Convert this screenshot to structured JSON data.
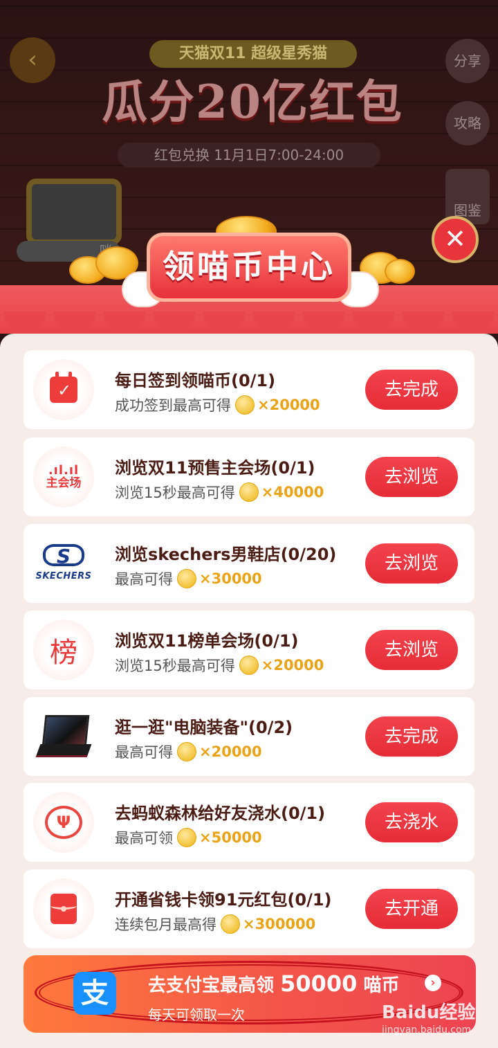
{
  "background": {
    "back_icon": "chevron-left-icon",
    "share_label": "分享",
    "guide_label": "攻略",
    "collection_label": "图鉴",
    "banner_subtitle": "天猫双11 超级星秀猫",
    "banner_title": "瓜分20亿红包",
    "banner_date": "红包兑换 11月1日7:00-24:00",
    "tv_label": "咪"
  },
  "modal": {
    "title": "领喵币中心",
    "close_icon": "close-icon"
  },
  "tasks": [
    {
      "icon": "calendar-check-icon",
      "title": "每日签到领喵币(0/1)",
      "desc": "成功签到最高可得",
      "reward": "×20000",
      "button": "去完成"
    },
    {
      "icon": "main-venue-icon",
      "icon_text": "主会场",
      "title": "浏览双11预售主会场(0/1)",
      "desc": "浏览15秒最高可得",
      "reward": "×40000",
      "button": "去浏览"
    },
    {
      "icon": "skechers-logo-icon",
      "icon_text": "SKECHERS",
      "title": "浏览skechers男鞋店(0/20)",
      "desc": "最高可得",
      "reward": "×30000",
      "button": "去浏览"
    },
    {
      "icon": "ranking-icon",
      "icon_text": "榜",
      "title": "浏览双11榜单会场(0/1)",
      "desc": "浏览15秒最高可得",
      "reward": "×20000",
      "button": "去浏览"
    },
    {
      "icon": "laptop-icon",
      "title": "逛一逛\"电脑装备\"(0/2)",
      "desc": "最高可得",
      "reward": "×20000",
      "button": "去完成"
    },
    {
      "icon": "sprout-icon",
      "title": "去蚂蚁森林给好友浇水(0/1)",
      "desc": "最高可领",
      "reward": "×50000",
      "button": "去浇水"
    },
    {
      "icon": "red-envelope-icon",
      "title": "开通省钱卡领91元红包(0/1)",
      "desc": "连续包月最高得",
      "reward": "×300000",
      "button": "去开通"
    }
  ],
  "alipay_banner": {
    "logo_text": "支",
    "title_prefix": "去支付宝最高领",
    "title_amount": "50000",
    "title_suffix": "喵币",
    "subtitle": "每天可领取一次"
  },
  "watermark": {
    "text": "Baidu经验",
    "url": "jingyan.baidu.com"
  },
  "colors": {
    "accent": "#e52c37",
    "reward": "#e8a317",
    "panel": "#f8ece8",
    "alipay_blue": "#1890ff"
  }
}
